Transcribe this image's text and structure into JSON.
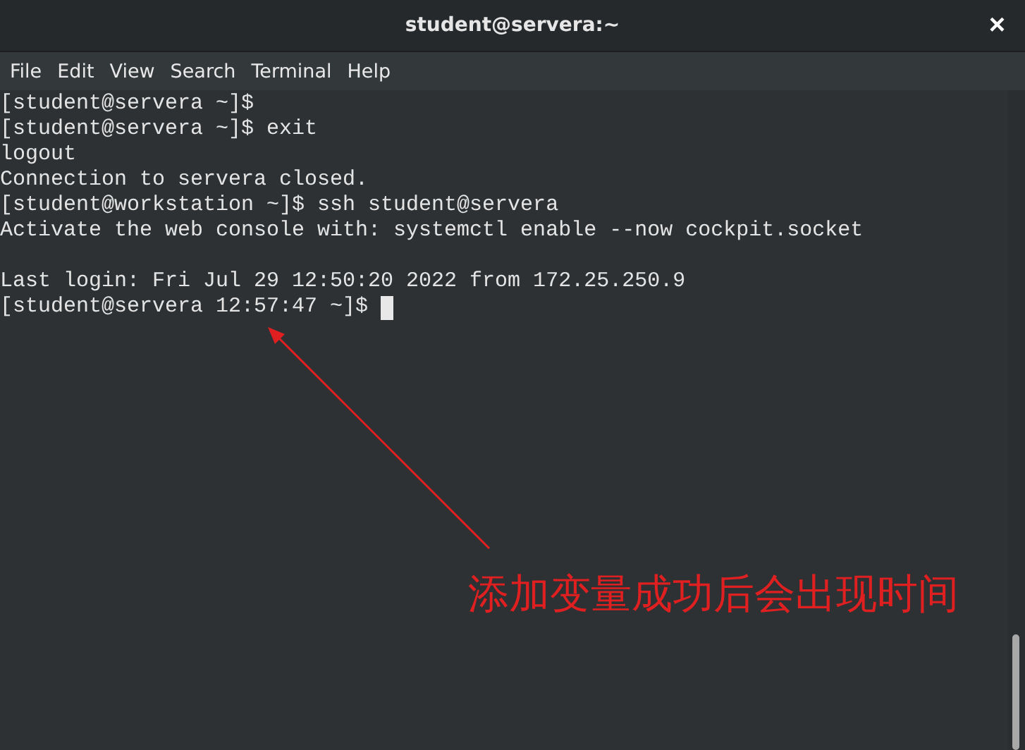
{
  "window": {
    "title": "student@servera:~",
    "close": "×"
  },
  "menu": [
    "File",
    "Edit",
    "View",
    "Search",
    "Terminal",
    "Help"
  ],
  "terminal": {
    "lines": [
      {
        "kind": "text",
        "text": "[student@servera ~]$",
        "cursor": false
      },
      {
        "kind": "text",
        "text": "[student@servera ~]$ exit",
        "cursor": false
      },
      {
        "kind": "text",
        "text": "logout",
        "cursor": false
      },
      {
        "kind": "text",
        "text": "Connection to servera closed.",
        "cursor": false
      },
      {
        "kind": "text",
        "text": "[student@workstation ~]$ ssh student@servera",
        "cursor": false
      },
      {
        "kind": "text",
        "text": "Activate the web console with: systemctl enable --now cockpit.socket",
        "cursor": false
      },
      {
        "kind": "blank"
      },
      {
        "kind": "text",
        "text": "Last login: Fri Jul 29 12:50:20 2022 from 172.25.250.9",
        "cursor": false
      },
      {
        "kind": "text",
        "text": "[student@servera 12:57:47 ~]$",
        "cursor": true
      }
    ]
  },
  "annotation": {
    "text": "添加变量成功后会出现时间",
    "color": "#e02020"
  }
}
